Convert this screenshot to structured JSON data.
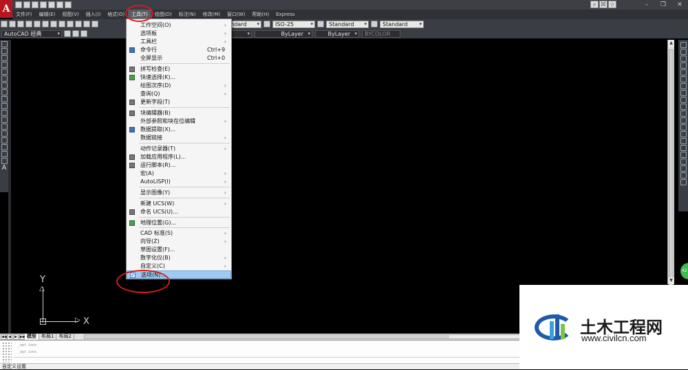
{
  "app": {
    "logo_letter": "A"
  },
  "menubar": {
    "items": [
      "文件(F)",
      "编辑(E)",
      "视图(V)",
      "插入(I)",
      "格式(O)",
      "工具(T)",
      "绘图(D)",
      "标注(N)",
      "修改(M)",
      "窗口(W)",
      "帮助(H)",
      "Express"
    ],
    "active_index": 5
  },
  "toolbar": {
    "text_style": "Standard",
    "dim_style": "ISO-25",
    "table_style": "Standard",
    "multileader_style": "Standard",
    "workspace": "AutoCAD 经典",
    "layer_color": "ByLayer",
    "linetype": "ByLayer",
    "lineweight": "ByLayer",
    "plot_style": "BYCOLOR"
  },
  "tools_menu": {
    "items": [
      {
        "label": "工作空间(O)",
        "shortcut": "",
        "submenu": true,
        "icon": ""
      },
      {
        "label": "选项板",
        "shortcut": "",
        "submenu": true,
        "icon": ""
      },
      {
        "label": "工具栏",
        "shortcut": "",
        "submenu": true,
        "icon": ""
      },
      {
        "label": "命令行",
        "shortcut": "Ctrl+9",
        "submenu": false,
        "icon": "command-line-icon"
      },
      {
        "label": "全屏显示",
        "shortcut": "Ctrl+0",
        "submenu": false,
        "icon": ""
      },
      {
        "label": "拼写检查(E)",
        "shortcut": "",
        "submenu": false,
        "icon": "spell-check-icon"
      },
      {
        "label": "快速选择(K)...",
        "shortcut": "",
        "submenu": false,
        "icon": "quick-select-icon"
      },
      {
        "label": "绘图次序(D)",
        "shortcut": "",
        "submenu": true,
        "icon": ""
      },
      {
        "label": "查询(Q)",
        "shortcut": "",
        "submenu": true,
        "icon": ""
      },
      {
        "label": "更新字段(T)",
        "shortcut": "",
        "submenu": false,
        "icon": "update-field-icon"
      },
      {
        "label": "块编辑器(B)",
        "shortcut": "",
        "submenu": false,
        "icon": "block-editor-icon"
      },
      {
        "label": "外部参照和块在位编辑",
        "shortcut": "",
        "submenu": true,
        "icon": ""
      },
      {
        "label": "数据提取(X)...",
        "shortcut": "",
        "submenu": false,
        "icon": "data-extraction-icon"
      },
      {
        "label": "数据链接",
        "shortcut": "",
        "submenu": true,
        "icon": ""
      },
      {
        "label": "动作记录器(T)",
        "shortcut": "",
        "submenu": true,
        "icon": ""
      },
      {
        "label": "加载应用程序(L)...",
        "shortcut": "",
        "submenu": false,
        "icon": "load-app-icon"
      },
      {
        "label": "运行脚本(R)...",
        "shortcut": "",
        "submenu": false,
        "icon": "run-script-icon"
      },
      {
        "label": "宏(A)",
        "shortcut": "",
        "submenu": true,
        "icon": ""
      },
      {
        "label": "AutoLISP(I)",
        "shortcut": "",
        "submenu": true,
        "icon": ""
      },
      {
        "label": "显示图像(Y)",
        "shortcut": "",
        "submenu": true,
        "icon": ""
      },
      {
        "label": "新建 UCS(W)",
        "shortcut": "",
        "submenu": true,
        "icon": ""
      },
      {
        "label": "命名 UCS(U)...",
        "shortcut": "",
        "submenu": false,
        "icon": "named-ucs-icon"
      },
      {
        "label": "地理位置(G)...",
        "shortcut": "",
        "submenu": false,
        "icon": "geolocation-icon"
      },
      {
        "label": "CAD 标准(S)",
        "shortcut": "",
        "submenu": true,
        "icon": ""
      },
      {
        "label": "向导(Z)",
        "shortcut": "",
        "submenu": true,
        "icon": ""
      },
      {
        "label": "草图设置(F)...",
        "shortcut": "",
        "submenu": false,
        "icon": ""
      },
      {
        "label": "数字化仪(B)",
        "shortcut": "",
        "submenu": true,
        "icon": ""
      },
      {
        "label": "自定义(C)",
        "shortcut": "",
        "submenu": true,
        "icon": ""
      },
      {
        "label": "选项(N)...",
        "shortcut": "",
        "submenu": false,
        "icon": "options-icon",
        "highlighted": true
      }
    ]
  },
  "ucs": {
    "y_label": "Y",
    "x_label": "X"
  },
  "layout_tabs": [
    "模型",
    "布局1",
    "布局2"
  ],
  "command_history": [
    "_opt ions",
    "_opt ions"
  ],
  "status": "自定义设置",
  "watermark": {
    "title": "土木工程网",
    "url": "www.civilcn.com"
  },
  "side_badge": "42"
}
